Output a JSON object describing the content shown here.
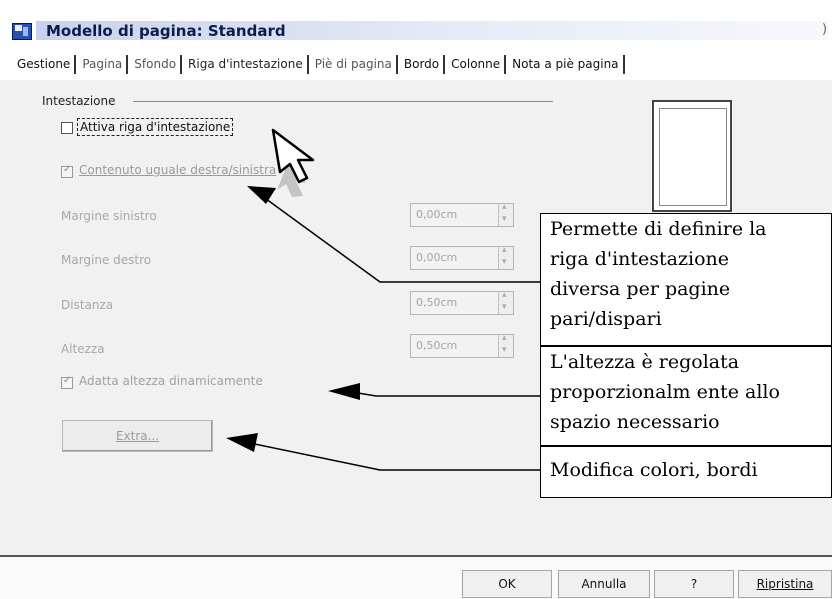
{
  "window": {
    "title": "Modello di pagina: Standard",
    "close_glyph": ")"
  },
  "tabs": [
    {
      "label": "Gestione"
    },
    {
      "label": "Pagina"
    },
    {
      "label": "Sfondo"
    },
    {
      "label": "Riga d'intestazione"
    },
    {
      "label": "Piè di pagina"
    },
    {
      "label": "Bordo"
    },
    {
      "label": "Colonne"
    },
    {
      "label": "Nota a piè pagina"
    }
  ],
  "active_tab": "Riga d'intestazione",
  "header_group": {
    "title": "Intestazione",
    "activate_checkbox": {
      "label": "Attiva riga d'intestazione",
      "checked": false
    },
    "same_content_checkbox": {
      "label": "Contenuto uguale destra/sinistra",
      "checked": true,
      "enabled": false
    },
    "left_margin": {
      "label": "Margine sinistro",
      "value": "0,00cm"
    },
    "right_margin": {
      "label": "Margine destro",
      "value": "0,00cm"
    },
    "spacing": {
      "label": "Distanza",
      "value": "0,50cm"
    },
    "height": {
      "label": "Altezza",
      "value": "0,50cm"
    },
    "autofit_checkbox": {
      "label": "Adatta altezza dinamicamente",
      "checked": true,
      "enabled": false
    },
    "extra_button": {
      "label": "Extra..."
    }
  },
  "annotations": {
    "box1": [
      "Permette di definire la",
      "riga d'intestazione",
      "diversa per pagine",
      "pari/dispari"
    ],
    "box2": [
      "L'altezza è regolata",
      "proporzionalm ente allo",
      "spazio necessario"
    ],
    "box3": [
      "Modifica colori, bordi"
    ]
  },
  "footer": {
    "ok": "OK",
    "cancel": "Annulla",
    "help": "?",
    "reset": "Ripristina"
  },
  "colors": {
    "title_band": "#c8d2ec",
    "dialog_bg": "#f1f1f1",
    "disabled_text": "#a8a8a8"
  }
}
